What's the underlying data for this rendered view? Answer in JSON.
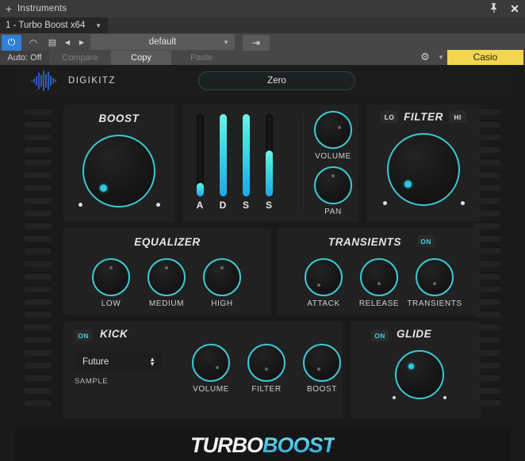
{
  "titlebar": {
    "plus_icon": "+",
    "title": "Instruments",
    "pin_icon": "pin-icon",
    "close_icon": "close-icon"
  },
  "instrument_selector": {
    "value": "1 - Turbo Boost x64",
    "caret": "▼"
  },
  "toolbar": {
    "power_label": "⏻",
    "bypass_label": "◠",
    "doc_label": "▤",
    "prev_label": "◀",
    "next_label": "▶",
    "preset_name": "default",
    "preset_caret": "▼",
    "save_label": "⇥",
    "auto_label": "Auto: Off",
    "compare_label": "Compare",
    "copy_label": "Copy",
    "paste_label": "Paste",
    "gear_label": "⚙",
    "gear_caret": "▼",
    "account_label": "Casio",
    "accent_active": "#2f7fd8",
    "account_bg": "#f3d54e"
  },
  "brand": {
    "name": "DIGIKITZ",
    "zero_label": "Zero"
  },
  "boost": {
    "title": "BOOST",
    "value_pct": 0
  },
  "adsr": {
    "sliders": [
      {
        "label": "A",
        "value_pct": 16
      },
      {
        "label": "D",
        "value_pct": 100
      },
      {
        "label": "S",
        "value_pct": 100
      },
      {
        "label": "S",
        "value_pct": 56
      }
    ],
    "volume_label": "VOLUME",
    "volume_pct": 62,
    "pan_label": "PAN",
    "pan_pct": 50
  },
  "filter": {
    "title": "FILTER",
    "lo_label": "LO",
    "hi_label": "HI",
    "value_pct": 10
  },
  "equalizer": {
    "title": "EQUALIZER",
    "knobs": [
      {
        "label": "LOW",
        "value_pct": 50
      },
      {
        "label": "MEDIUM",
        "value_pct": 50
      },
      {
        "label": "HIGH",
        "value_pct": 50
      }
    ]
  },
  "transients": {
    "title": "TRANSIENTS",
    "on_label": "ON",
    "knobs": [
      {
        "label": "ATTACK",
        "value_pct": 38
      },
      {
        "label": "RELEASE",
        "value_pct": 50
      },
      {
        "label": "TRANSIENTS",
        "value_pct": 50
      }
    ]
  },
  "kick": {
    "on_label": "ON",
    "title": "KICK",
    "sample_value": "Future",
    "sample_label": "SAMPLE",
    "spin_up": "▲",
    "spin_down": "▼",
    "knobs": [
      {
        "label": "VOLUME",
        "value_pct": 52
      },
      {
        "label": "FILTER",
        "value_pct": 50
      },
      {
        "label": "BOOST",
        "value_pct": 46
      }
    ]
  },
  "glide": {
    "on_label": "ON",
    "title": "GLIDE",
    "value_pct": 22
  },
  "footer": {
    "logo_part1": "TURBO",
    "logo_part2": "BOOST"
  },
  "theme": {
    "accent": "#3ec8d2",
    "panel_bg": "#212121",
    "body_bg": "#1a1a1a"
  }
}
